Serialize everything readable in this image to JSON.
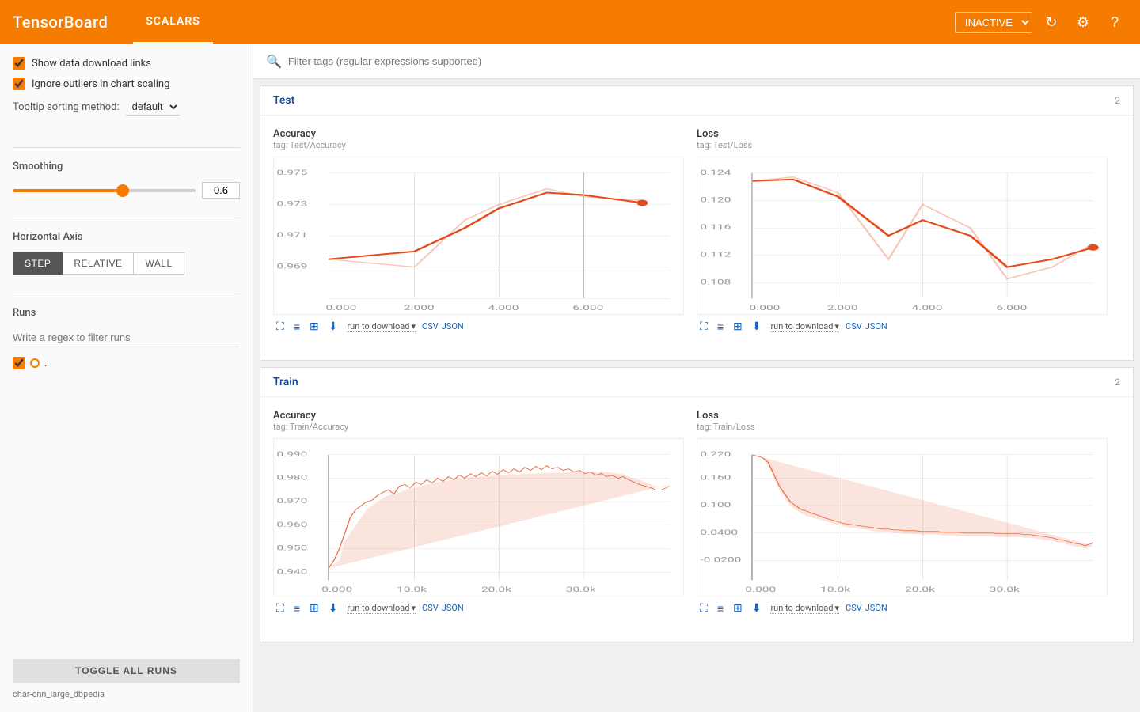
{
  "header": {
    "logo": "TensorBoard",
    "nav_item": "SCALARS",
    "inactive_label": "INACTIVE",
    "refresh_icon": "↻",
    "settings_icon": "⚙",
    "help_icon": "?"
  },
  "sidebar": {
    "show_data_label": "Show data download links",
    "ignore_outliers_label": "Ignore outliers in chart scaling",
    "tooltip_label": "Tooltip sorting method:",
    "tooltip_value": "default",
    "smoothing_label": "Smoothing",
    "smoothing_value": "0.6",
    "horizontal_axis_label": "Horizontal Axis",
    "axis_buttons": [
      "STEP",
      "RELATIVE",
      "WALL"
    ],
    "active_axis": "STEP",
    "runs_label": "Runs",
    "runs_placeholder": "Write a regex to filter runs",
    "run_dot_color": "#f57c00",
    "run_label": ".",
    "toggle_all_label": "TOGGLE ALL RUNS",
    "run_name": "char-cnn_large_dbpedia"
  },
  "filter": {
    "placeholder": "Filter tags (regular expressions supported)"
  },
  "test_section": {
    "title": "Test",
    "count": "2",
    "charts": [
      {
        "title": "Accuracy",
        "tag": "tag: Test/Accuracy",
        "y_labels": [
          "0.975",
          "0.973",
          "0.971",
          "0.969"
        ],
        "x_labels": [
          "0.000",
          "2.000",
          "4.000",
          "6.000"
        ]
      },
      {
        "title": "Loss",
        "tag": "tag: Test/Loss",
        "y_labels": [
          "0.124",
          "0.120",
          "0.116",
          "0.112",
          "0.108"
        ],
        "x_labels": [
          "0.000",
          "2.000",
          "4.000",
          "6.000"
        ]
      }
    ],
    "run_to_download": "run to download",
    "csv_label": "CSV",
    "json_label": "JSON"
  },
  "train_section": {
    "title": "Train",
    "count": "2",
    "charts": [
      {
        "title": "Accuracy",
        "tag": "tag: Train/Accuracy",
        "y_labels": [
          "0.990",
          "0.980",
          "0.970",
          "0.960",
          "0.950",
          "0.940"
        ],
        "x_labels": [
          "0.000",
          "10.0k",
          "20.0k",
          "30.0k"
        ]
      },
      {
        "title": "Loss",
        "tag": "tag: Train/Loss",
        "y_labels": [
          "0.220",
          "0.160",
          "0.100",
          "0.0400",
          "-0.0200"
        ],
        "x_labels": [
          "0.000",
          "10.0k",
          "20.0k",
          "30.0k"
        ]
      }
    ],
    "run_to_download": "run to download",
    "csv_label": "CSV",
    "json_label": "JSON"
  },
  "colors": {
    "orange": "#f57c00",
    "blue": "#1565c0",
    "chart_line": "#e64a19",
    "chart_fill": "rgba(230,74,25,0.2)"
  }
}
